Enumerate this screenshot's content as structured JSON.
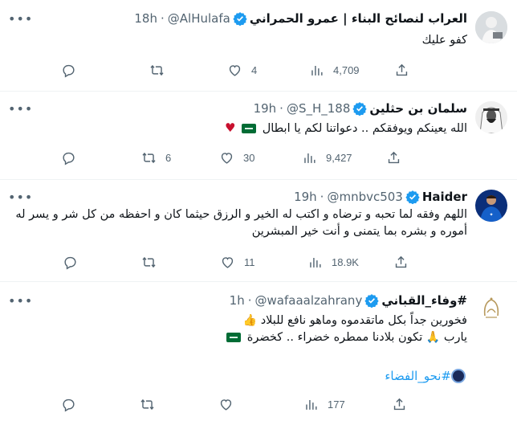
{
  "tweets": [
    {
      "name": "العراب لنصائح البناء | عمرو الحمراني",
      "handle": "@AlHulafa",
      "time": "18h",
      "text": "كفو عليك",
      "reply_count": "",
      "retweet_count": "",
      "like_count": "4",
      "view_count": "4,709"
    },
    {
      "name": "سلمان بن حثلين",
      "handle": "@S_H_188",
      "time": "19h",
      "text": "الله يعينكم ويوفقكم .. دعواتنا لكم يا ابطال",
      "reply_count": "",
      "retweet_count": "6",
      "like_count": "30",
      "view_count": "9,427"
    },
    {
      "name": "Haider",
      "handle": "@mnbvc503",
      "time": "19h",
      "text": "اللهم وفقه لما تحبه و ترضاه و اكتب له الخير و الرزق حيثما كان و احفظه من كل شر و يسر له أموره و بشره بما يتمنى و أنت خير المبشرين",
      "reply_count": "",
      "retweet_count": "",
      "like_count": "11",
      "view_count": "18.9K"
    },
    {
      "name": "وفاء_القباني#",
      "handle": "@wafaaalzahrany",
      "time": "1h",
      "line1": "فخورين جداً بكل ماتقدموه وماهو نافع للبلاد",
      "line2_a": "يارب",
      "line2_b": "تكون بلادنا ممطره خضراء .. كخضرة",
      "hashtag": "#نحو_الفضاء",
      "reply_count": "",
      "retweet_count": "",
      "like_count": "",
      "view_count": "177"
    }
  ],
  "icons": {
    "reply": "reply-icon",
    "retweet": "retweet-icon",
    "like": "like-icon",
    "views": "views-icon",
    "share": "share-icon",
    "verified": "verified-badge-icon",
    "more": "more-icon"
  },
  "colors": {
    "verified": "#1d9bf0",
    "muted": "#536471",
    "hashtag": "#1d9bf0",
    "divider": "#eff3f4"
  }
}
